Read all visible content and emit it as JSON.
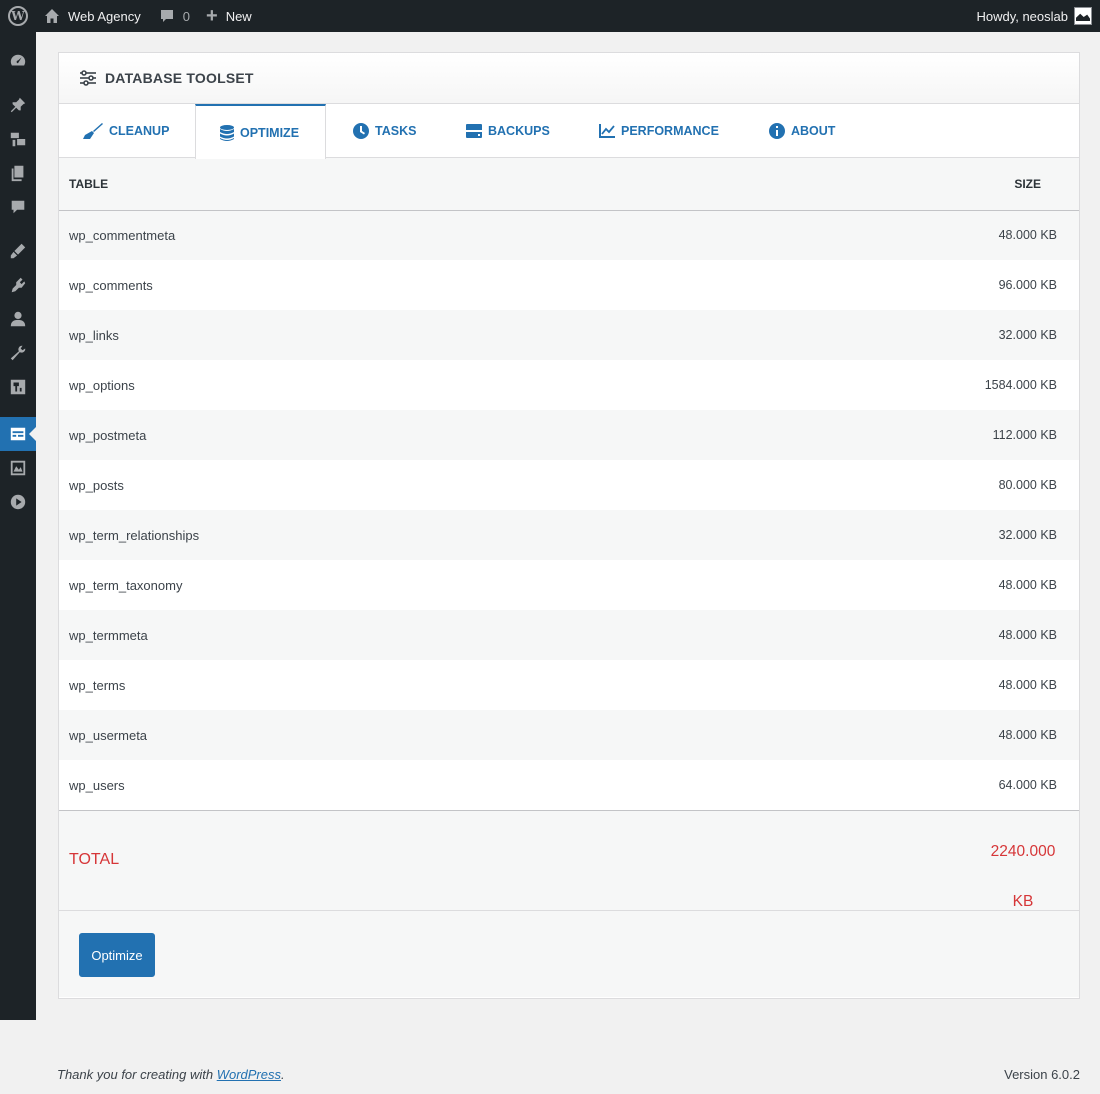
{
  "adminbar": {
    "site_name": "Web Agency",
    "comments_count": "0",
    "new_label": "New",
    "howdy": "Howdy, neoslab",
    "icons": [
      "wordpress-logo-icon",
      "home-icon",
      "comment-icon",
      "plus-icon",
      "avatar"
    ]
  },
  "sidebar": {
    "icons": [
      "dashboard-icon",
      "pin-icon",
      "media-icon",
      "pages-icon",
      "comments-icon",
      "appearance-icon",
      "plugins-icon",
      "users-icon",
      "tools-icon",
      "settings-icon",
      "database-toolset-icon",
      "gallery-icon",
      "play-icon"
    ],
    "current": "database-toolset-icon"
  },
  "panel": {
    "title": "DATABASE TOOLSET",
    "tabs": [
      {
        "label": "CLEANUP",
        "icon": "broom-icon"
      },
      {
        "label": "OPTIMIZE",
        "icon": "database-icon",
        "active": true
      },
      {
        "label": "TASKS",
        "icon": "clock-icon"
      },
      {
        "label": "BACKUPS",
        "icon": "drive-icon"
      },
      {
        "label": "PERFORMANCE",
        "icon": "line-chart-icon"
      },
      {
        "label": "ABOUT",
        "icon": "info-icon"
      }
    ],
    "columns": {
      "table": "TABLE",
      "size": "SIZE"
    },
    "rows": [
      {
        "name": "wp_commentmeta",
        "size": "48.000 KB"
      },
      {
        "name": "wp_comments",
        "size": "96.000 KB"
      },
      {
        "name": "wp_links",
        "size": "32.000 KB"
      },
      {
        "name": "wp_options",
        "size": "1584.000 KB"
      },
      {
        "name": "wp_postmeta",
        "size": "112.000 KB"
      },
      {
        "name": "wp_posts",
        "size": "80.000 KB"
      },
      {
        "name": "wp_term_relationships",
        "size": "32.000 KB"
      },
      {
        "name": "wp_term_taxonomy",
        "size": "48.000 KB"
      },
      {
        "name": "wp_termmeta",
        "size": "48.000 KB"
      },
      {
        "name": "wp_terms",
        "size": "48.000 KB"
      },
      {
        "name": "wp_usermeta",
        "size": "48.000 KB"
      },
      {
        "name": "wp_users",
        "size": "64.000 KB"
      }
    ],
    "total_label": "TOTAL",
    "total_value": "2240.000",
    "total_unit": "KB",
    "optimize_button": "Optimize"
  },
  "footer": {
    "thanks_prefix": "Thank you for creating with ",
    "thanks_link": "WordPress",
    "thanks_suffix": ".",
    "version": "Version 6.0.2"
  },
  "colors": {
    "accent": "#2271b1",
    "total": "#d63638",
    "adminbar": "#1d2327"
  }
}
